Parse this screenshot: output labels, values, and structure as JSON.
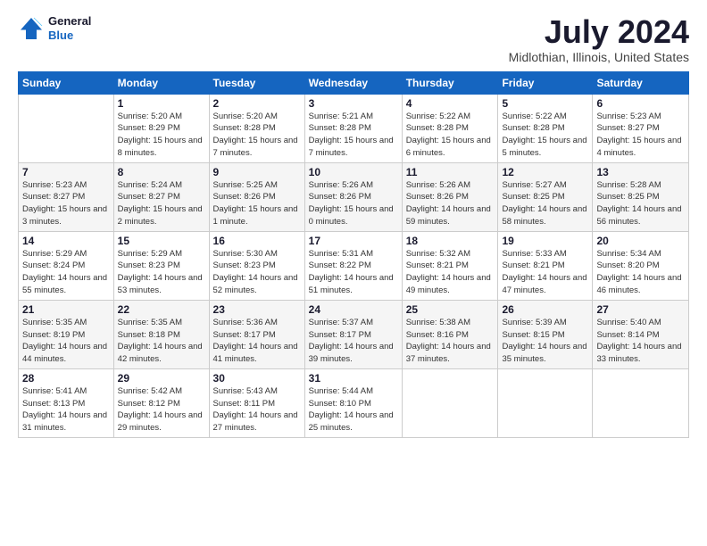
{
  "logo": {
    "general": "General",
    "blue": "Blue"
  },
  "title": "July 2024",
  "location": "Midlothian, Illinois, United States",
  "days_of_week": [
    "Sunday",
    "Monday",
    "Tuesday",
    "Wednesday",
    "Thursday",
    "Friday",
    "Saturday"
  ],
  "weeks": [
    [
      {
        "day": "",
        "info": ""
      },
      {
        "day": "1",
        "info": "Sunrise: 5:20 AM\nSunset: 8:29 PM\nDaylight: 15 hours\nand 8 minutes."
      },
      {
        "day": "2",
        "info": "Sunrise: 5:20 AM\nSunset: 8:28 PM\nDaylight: 15 hours\nand 7 minutes."
      },
      {
        "day": "3",
        "info": "Sunrise: 5:21 AM\nSunset: 8:28 PM\nDaylight: 15 hours\nand 7 minutes."
      },
      {
        "day": "4",
        "info": "Sunrise: 5:22 AM\nSunset: 8:28 PM\nDaylight: 15 hours\nand 6 minutes."
      },
      {
        "day": "5",
        "info": "Sunrise: 5:22 AM\nSunset: 8:28 PM\nDaylight: 15 hours\nand 5 minutes."
      },
      {
        "day": "6",
        "info": "Sunrise: 5:23 AM\nSunset: 8:27 PM\nDaylight: 15 hours\nand 4 minutes."
      }
    ],
    [
      {
        "day": "7",
        "info": "Sunrise: 5:23 AM\nSunset: 8:27 PM\nDaylight: 15 hours\nand 3 minutes."
      },
      {
        "day": "8",
        "info": "Sunrise: 5:24 AM\nSunset: 8:27 PM\nDaylight: 15 hours\nand 2 minutes."
      },
      {
        "day": "9",
        "info": "Sunrise: 5:25 AM\nSunset: 8:26 PM\nDaylight: 15 hours\nand 1 minute."
      },
      {
        "day": "10",
        "info": "Sunrise: 5:26 AM\nSunset: 8:26 PM\nDaylight: 15 hours\nand 0 minutes."
      },
      {
        "day": "11",
        "info": "Sunrise: 5:26 AM\nSunset: 8:26 PM\nDaylight: 14 hours\nand 59 minutes."
      },
      {
        "day": "12",
        "info": "Sunrise: 5:27 AM\nSunset: 8:25 PM\nDaylight: 14 hours\nand 58 minutes."
      },
      {
        "day": "13",
        "info": "Sunrise: 5:28 AM\nSunset: 8:25 PM\nDaylight: 14 hours\nand 56 minutes."
      }
    ],
    [
      {
        "day": "14",
        "info": "Sunrise: 5:29 AM\nSunset: 8:24 PM\nDaylight: 14 hours\nand 55 minutes."
      },
      {
        "day": "15",
        "info": "Sunrise: 5:29 AM\nSunset: 8:23 PM\nDaylight: 14 hours\nand 53 minutes."
      },
      {
        "day": "16",
        "info": "Sunrise: 5:30 AM\nSunset: 8:23 PM\nDaylight: 14 hours\nand 52 minutes."
      },
      {
        "day": "17",
        "info": "Sunrise: 5:31 AM\nSunset: 8:22 PM\nDaylight: 14 hours\nand 51 minutes."
      },
      {
        "day": "18",
        "info": "Sunrise: 5:32 AM\nSunset: 8:21 PM\nDaylight: 14 hours\nand 49 minutes."
      },
      {
        "day": "19",
        "info": "Sunrise: 5:33 AM\nSunset: 8:21 PM\nDaylight: 14 hours\nand 47 minutes."
      },
      {
        "day": "20",
        "info": "Sunrise: 5:34 AM\nSunset: 8:20 PM\nDaylight: 14 hours\nand 46 minutes."
      }
    ],
    [
      {
        "day": "21",
        "info": "Sunrise: 5:35 AM\nSunset: 8:19 PM\nDaylight: 14 hours\nand 44 minutes."
      },
      {
        "day": "22",
        "info": "Sunrise: 5:35 AM\nSunset: 8:18 PM\nDaylight: 14 hours\nand 42 minutes."
      },
      {
        "day": "23",
        "info": "Sunrise: 5:36 AM\nSunset: 8:17 PM\nDaylight: 14 hours\nand 41 minutes."
      },
      {
        "day": "24",
        "info": "Sunrise: 5:37 AM\nSunset: 8:17 PM\nDaylight: 14 hours\nand 39 minutes."
      },
      {
        "day": "25",
        "info": "Sunrise: 5:38 AM\nSunset: 8:16 PM\nDaylight: 14 hours\nand 37 minutes."
      },
      {
        "day": "26",
        "info": "Sunrise: 5:39 AM\nSunset: 8:15 PM\nDaylight: 14 hours\nand 35 minutes."
      },
      {
        "day": "27",
        "info": "Sunrise: 5:40 AM\nSunset: 8:14 PM\nDaylight: 14 hours\nand 33 minutes."
      }
    ],
    [
      {
        "day": "28",
        "info": "Sunrise: 5:41 AM\nSunset: 8:13 PM\nDaylight: 14 hours\nand 31 minutes."
      },
      {
        "day": "29",
        "info": "Sunrise: 5:42 AM\nSunset: 8:12 PM\nDaylight: 14 hours\nand 29 minutes."
      },
      {
        "day": "30",
        "info": "Sunrise: 5:43 AM\nSunset: 8:11 PM\nDaylight: 14 hours\nand 27 minutes."
      },
      {
        "day": "31",
        "info": "Sunrise: 5:44 AM\nSunset: 8:10 PM\nDaylight: 14 hours\nand 25 minutes."
      },
      {
        "day": "",
        "info": ""
      },
      {
        "day": "",
        "info": ""
      },
      {
        "day": "",
        "info": ""
      }
    ]
  ]
}
